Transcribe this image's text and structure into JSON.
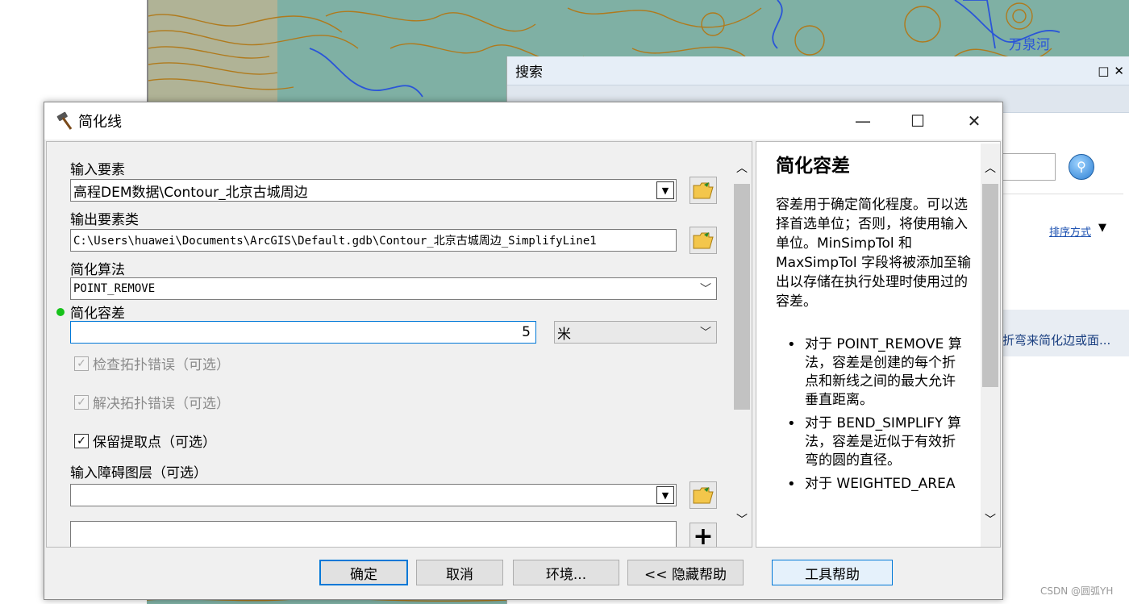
{
  "map": {
    "label": "万泉河"
  },
  "search_window": {
    "title": "搜索",
    "sort_label": "排序方式",
    "result_snippet": "折弯来简化边或面..."
  },
  "dialog": {
    "title": "简化线",
    "fields": {
      "input_features": {
        "label": "输入要素",
        "value": "高程DEM数据\\Contour_北京古城周边"
      },
      "output_class": {
        "label": "输出要素类",
        "value": "C:\\Users\\huawei\\Documents\\ArcGIS\\Default.gdb\\Contour_北京古城周边_SimplifyLine1"
      },
      "algorithm": {
        "label": "简化算法",
        "value": "POINT_REMOVE"
      },
      "tolerance": {
        "label": "简化容差",
        "value": "5",
        "unit": "米"
      },
      "check_topology": {
        "label": "检查拓扑错误（可选）",
        "checked": true,
        "disabled": true
      },
      "resolve_topology": {
        "label": "解决拓扑错误（可选）",
        "checked": true,
        "disabled": true
      },
      "keep_points": {
        "label": "保留提取点（可选）",
        "checked": true
      },
      "barriers": {
        "label": "输入障碍图层（可选）",
        "value": ""
      }
    },
    "help": {
      "title": "简化容差",
      "body": "容差用于确定简化程度。可以选择首选单位；否则，将使用输入单位。MinSimpTol 和 MaxSimpTol 字段将被添加至输出以存储在执行处理时使用过的容差。",
      "bullets": [
        "对于 POINT_REMOVE 算法，容差是创建的每个折点和新线之间的最大允许垂直距离。",
        "对于 BEND_SIMPLIFY 算法，容差是近似于有效折弯的圆的直径。",
        "对于 WEIGHTED_AREA"
      ]
    },
    "buttons": {
      "ok": "确定",
      "cancel": "取消",
      "env": "环境...",
      "hide_help": "<< 隐藏帮助",
      "tool_help": "工具帮助"
    }
  },
  "watermark": "CSDN @圆弧YH",
  "colors": {
    "accent": "#0078d7",
    "map_bg": "#7fb0a4",
    "contour": "#b07a1c",
    "river": "#2a55d8",
    "status_dot": "#17c21b"
  }
}
